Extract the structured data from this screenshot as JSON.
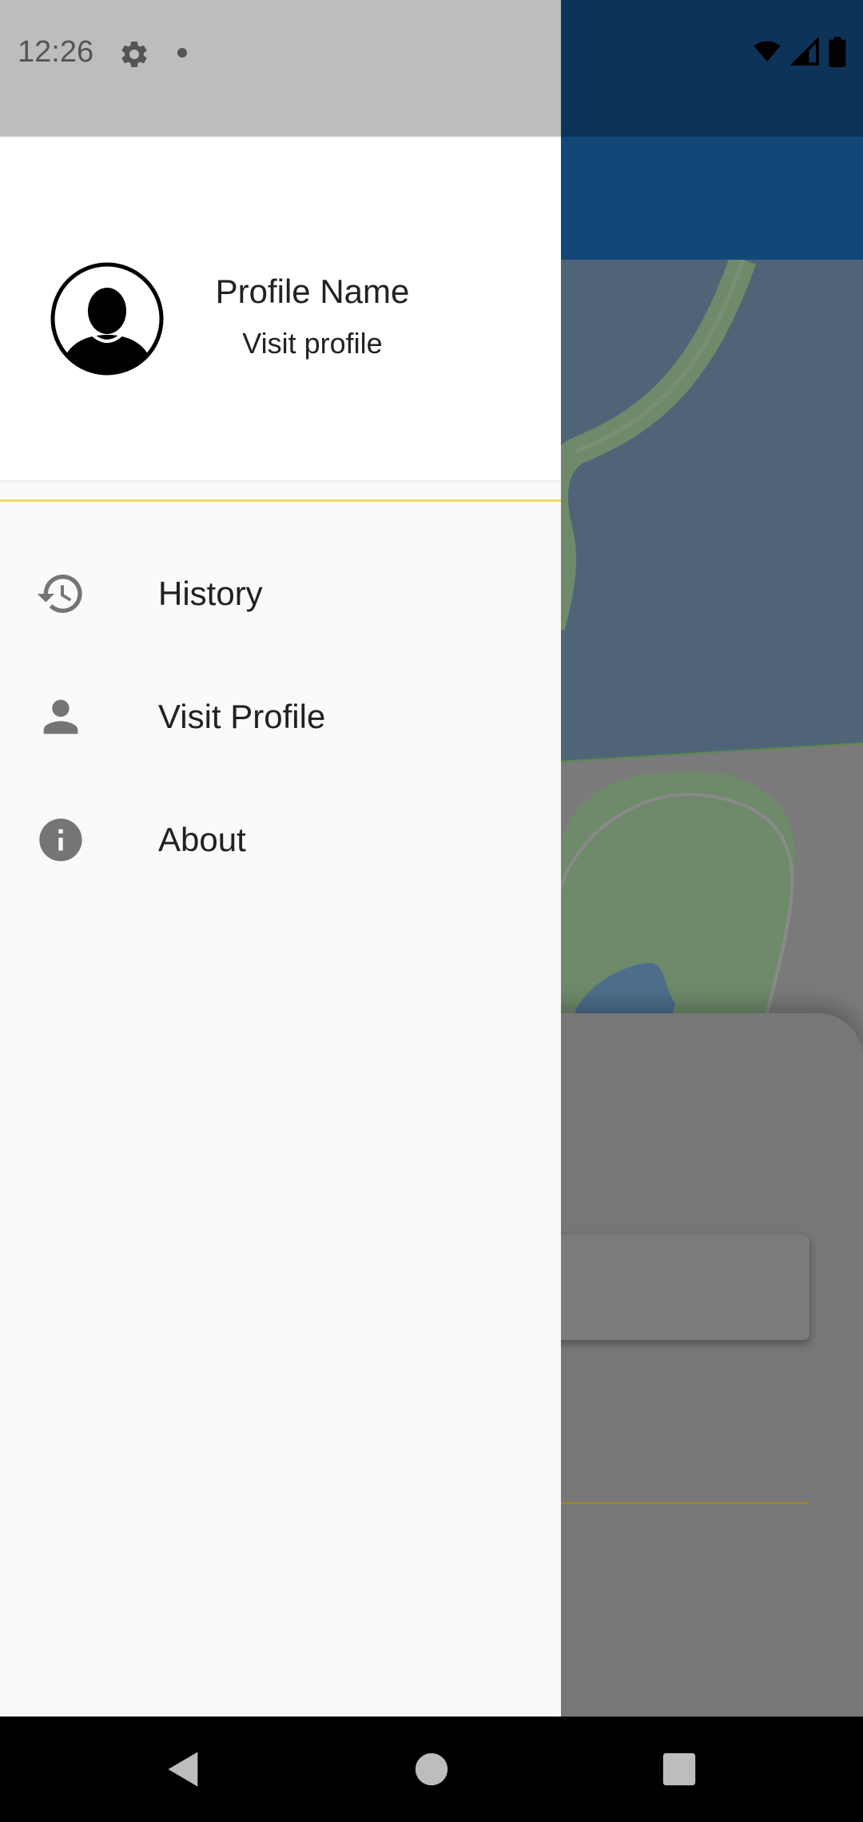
{
  "status_bar": {
    "time": "12:26"
  },
  "drawer": {
    "profile_name": "Profile Name",
    "visit_profile": "Visit profile",
    "menu": [
      {
        "label": "History",
        "icon": "history-icon"
      },
      {
        "label": "Visit Profile",
        "icon": "person-icon"
      },
      {
        "label": "About",
        "icon": "info-icon"
      }
    ]
  },
  "colors": {
    "accent_divider": "#f5d76e",
    "app_bar": "#124878",
    "icon_grey": "#757575"
  }
}
